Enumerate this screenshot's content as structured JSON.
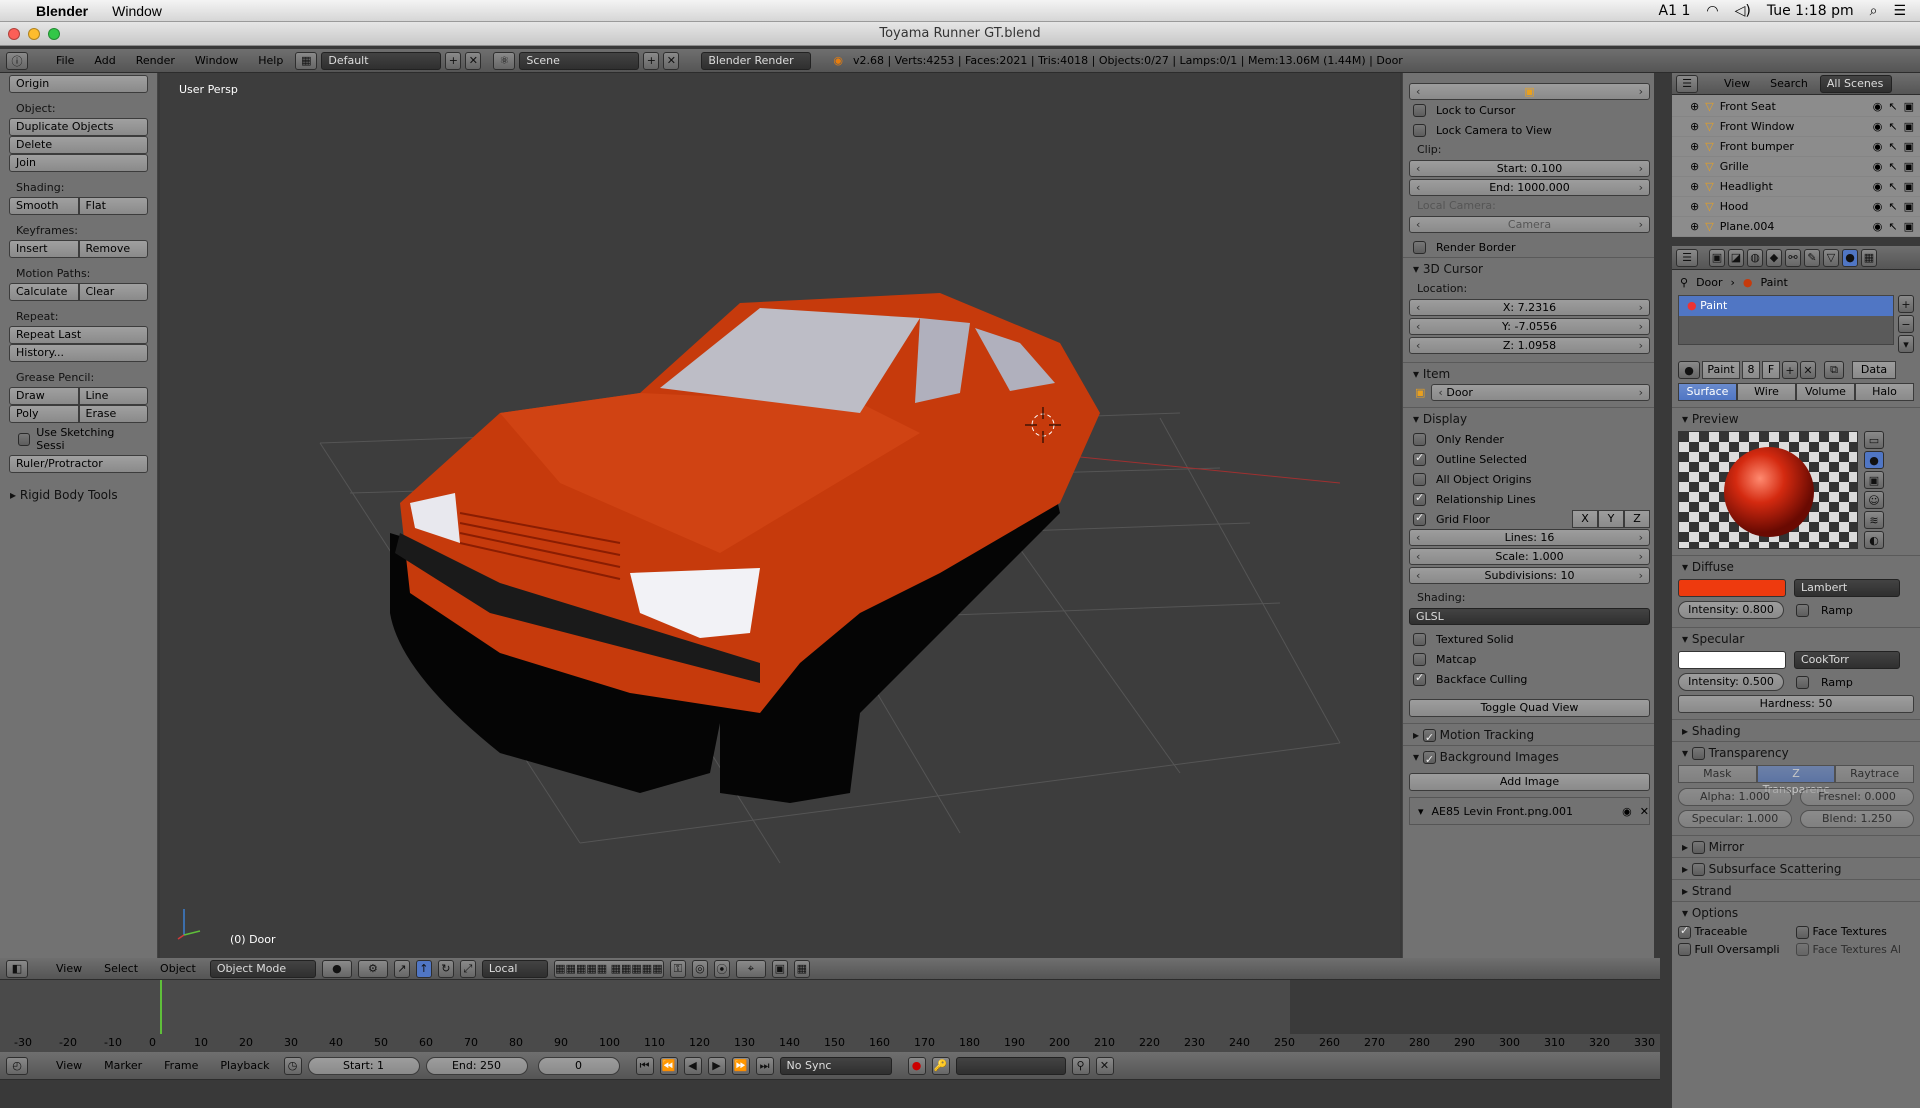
{
  "macos": {
    "app": "Blender",
    "menu": [
      "Window"
    ],
    "clock": "Tue 1:18 pm",
    "keyboard_badge": "A1 1"
  },
  "window": {
    "title": "Toyama Runner GT.blend"
  },
  "info_header": {
    "menus": [
      "File",
      "Add",
      "Render",
      "Window",
      "Help"
    ],
    "layout": "Default",
    "scene": "Scene",
    "engine": "Blender Render",
    "stats": "v2.68 | Verts:4253 | Faces:2021 | Tris:4018 | Objects:0/27 | Lamps:0/1 | Mem:13.06M (1.44M) | Door"
  },
  "toolshelf": {
    "origin": "Origin",
    "object_label": "Object:",
    "duplicate": "Duplicate Objects",
    "delete": "Delete",
    "join": "Join",
    "shading_label": "Shading:",
    "smooth": "Smooth",
    "flat": "Flat",
    "keyframes_label": "Keyframes:",
    "insert": "Insert",
    "remove": "Remove",
    "motion_label": "Motion Paths:",
    "calculate": "Calculate",
    "clear": "Clear",
    "repeat_label": "Repeat:",
    "repeat_last": "Repeat Last",
    "history": "History...",
    "grease_label": "Grease Pencil:",
    "draw": "Draw",
    "line": "Line",
    "poly": "Poly",
    "erase": "Erase",
    "sketching": "Use Sketching Sessi",
    "ruler": "Ruler/Protractor",
    "rigid": "Rigid Body Tools"
  },
  "viewport": {
    "persp": "User Persp",
    "object": "(0) Door",
    "car_color": "#c63a0c"
  },
  "npanel": {
    "lock_cursor": "Lock to Cursor",
    "lock_camera": "Lock Camera to View",
    "clip_label": "Clip:",
    "clip_start": "Start: 0.100",
    "clip_end": "End: 1000.000",
    "local_camera_label": "Local Camera:",
    "camera": "Camera",
    "render_border": "Render Border",
    "cursor_title": "3D Cursor",
    "location_label": "Location:",
    "cx": "X: 7.2316",
    "cy": "Y: -7.0556",
    "cz": "Z: 1.0958",
    "item_title": "Item",
    "item_name": "Door",
    "display_title": "Display",
    "only_render": "Only Render",
    "outline_selected": "Outline Selected",
    "all_origins": "All Object Origins",
    "relationship": "Relationship Lines",
    "grid_floor": "Grid Floor",
    "gx": "X",
    "gy": "Y",
    "gz": "Z",
    "lines": "Lines: 16",
    "scale": "Scale: 1.000",
    "subdiv": "Subdivisions: 10",
    "shading_label": "Shading:",
    "shading": "GLSL",
    "textured": "Textured Solid",
    "matcap": "Matcap",
    "backface": "Backface Culling",
    "quad": "Toggle Quad View",
    "motion_tracking": "Motion Tracking",
    "bg_images": "Background Images",
    "add_image": "Add Image",
    "bg_file": "AE85 Levin Front.png.001"
  },
  "outliner": {
    "menus": [
      "View",
      "Search"
    ],
    "filter": "All Scenes",
    "items": [
      "Front Seat",
      "Front Window",
      "Front bumper",
      "Grille",
      "Headlight",
      "Hood",
      "Plane.004"
    ]
  },
  "properties": {
    "breadcrumb": [
      "Door",
      "Paint"
    ],
    "material": "Paint",
    "mat_name": "Paint",
    "users": "8",
    "fake": "F",
    "data": "Data",
    "tabs": [
      "Surface",
      "Wire",
      "Volume",
      "Halo"
    ],
    "preview": "Preview",
    "diffuse": "Diffuse",
    "diffuse_color": "#ee3a0e",
    "diffuse_shader": "Lambert",
    "diffuse_intensity": "Intensity: 0.800",
    "ramp": "Ramp",
    "specular": "Specular",
    "spec_shader": "CookTorr",
    "spec_intensity": "Intensity: 0.500",
    "hardness": "Hardness: 50",
    "shading": "Shading",
    "transparency": "Transparency",
    "trans_tabs": [
      "Mask",
      "Z Transparenc",
      "Raytrace"
    ],
    "alpha": "Alpha: 1.000",
    "fresnel": "Fresnel: 0.000",
    "spec_t": "Specular: 1.000",
    "blend": "Blend: 1.250",
    "mirror": "Mirror",
    "sss": "Subsurface Scattering",
    "strand": "Strand",
    "options": "Options",
    "traceable": "Traceable",
    "face_textures": "Face Textures",
    "full_oversampling": "Full Oversampli",
    "face_textures_alpha": "Face Textures Al"
  },
  "view3d_header": {
    "menus": [
      "View",
      "Select",
      "Object"
    ],
    "mode": "Object Mode",
    "orientation": "Local"
  },
  "timeline": {
    "ticks": [
      "-30",
      "-20",
      "-10",
      "0",
      "10",
      "20",
      "30",
      "40",
      "50",
      "60",
      "70",
      "80",
      "90",
      "100",
      "110",
      "120",
      "130",
      "140",
      "150",
      "160",
      "170",
      "180",
      "190",
      "200",
      "210",
      "220",
      "230",
      "240",
      "250",
      "260",
      "270",
      "280",
      "290",
      "300",
      "310",
      "320",
      "330"
    ],
    "menus": [
      "View",
      "Marker",
      "Frame",
      "Playback"
    ],
    "start": "Start: 1",
    "end": "End: 250",
    "current": "0",
    "sync": "No Sync"
  }
}
